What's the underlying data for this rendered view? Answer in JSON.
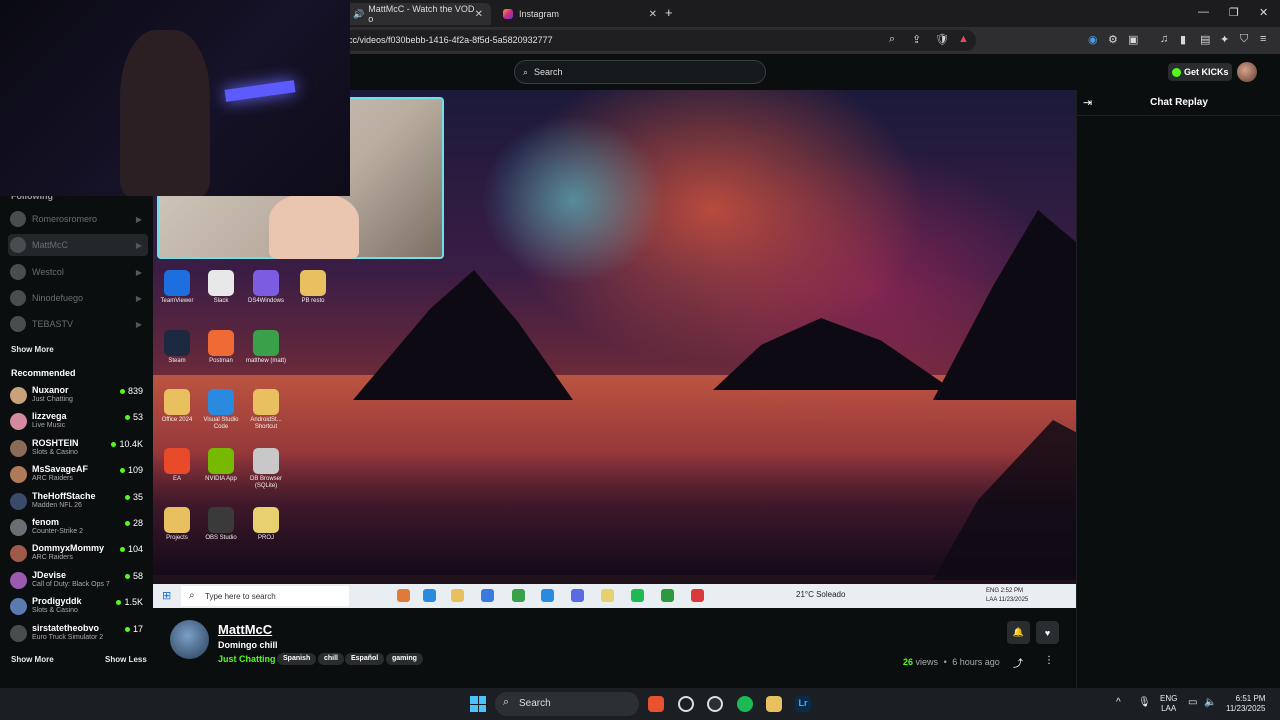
{
  "browser": {
    "tabs": [
      {
        "title": "MattMcC - Watch the VOD o",
        "active": true
      },
      {
        "title": "Instagram",
        "active": false
      }
    ],
    "new_tab": "+",
    "url": "cc/videos/f030bebb-1416-4f2a-8f5d-5a5820932777",
    "window_controls": [
      "—",
      "❐",
      "✕"
    ]
  },
  "header": {
    "search_placeholder": "Search",
    "get_kicks_label": "Get KICKs"
  },
  "sidebar": {
    "following_title": "Following",
    "following": [
      {
        "name": "Romerosromero",
        "selected": false
      },
      {
        "name": "MattMcC",
        "selected": true
      },
      {
        "name": "Westcol",
        "selected": false
      },
      {
        "name": "Ninodefuego",
        "selected": false
      },
      {
        "name": "TEBASTV",
        "selected": false
      }
    ],
    "show_more_following": "Show More",
    "recommended_title": "Recommended",
    "recommended": [
      {
        "name": "Nuxanor",
        "category": "Just Chatting",
        "viewers": "839",
        "color": "#c9a27a"
      },
      {
        "name": "lizzvega",
        "category": "Live Music",
        "viewers": "53",
        "color": "#d38aa0"
      },
      {
        "name": "ROSHTEIN",
        "category": "Slots & Casino",
        "viewers": "10.4K",
        "color": "#8a6b5a"
      },
      {
        "name": "MsSavageAF",
        "category": "ARC Raiders",
        "viewers": "109",
        "color": "#b07a5a"
      },
      {
        "name": "TheHoffStache",
        "category": "Madden NFL 26",
        "viewers": "35",
        "color": "#3a4a6a"
      },
      {
        "name": "fenom",
        "category": "Counter-Strike 2",
        "viewers": "28",
        "color": "#6a6f74"
      },
      {
        "name": "DommyxMommy",
        "category": "ARC Raiders",
        "viewers": "104",
        "color": "#a05a4a"
      },
      {
        "name": "JDevise",
        "category": "Call of Duty: Black Ops 7",
        "viewers": "58",
        "color": "#9a5ab0"
      },
      {
        "name": "Prodigyddk",
        "category": "Slots & Casino",
        "viewers": "1.5K",
        "color": "#5a7ab0"
      },
      {
        "name": "sirstatetheobvo",
        "category": "Euro Truck Simulator 2",
        "viewers": "17",
        "color": "#4a4d50"
      }
    ],
    "show_more": "Show More",
    "show_less": "Show Less"
  },
  "video": {
    "desktop_icons": [
      {
        "label": "TeamViewer",
        "color": "#1d6fe0"
      },
      {
        "label": "Slack",
        "color": "#e8e8e8"
      },
      {
        "label": "DS4Windows",
        "color": "#7c5ce0"
      },
      {
        "label": "PB resto",
        "color": "#e8c060"
      },
      {
        "label": "Steam",
        "color": "#1b2a40"
      },
      {
        "label": "Postman",
        "color": "#f06a35"
      },
      {
        "label": "matthew (matt)",
        "color": "#3aa04a"
      },
      {
        "label": "Office 2024",
        "color": "#e8c060"
      },
      {
        "label": "Visual Studio Code",
        "color": "#2a8ae0"
      },
      {
        "label": "AndroidSt... Shortcut",
        "color": "#e8c060"
      },
      {
        "label": "EA",
        "color": "#e84a2a"
      },
      {
        "label": "NVIDIA App",
        "color": "#76b900"
      },
      {
        "label": "DB Browser (SQLite)",
        "color": "#c8c8c8"
      },
      {
        "label": "Projects",
        "color": "#e8c060"
      },
      {
        "label": "OBS Studio",
        "color": "#3a3a3a"
      },
      {
        "label": "PROJ",
        "color": "#e8d070"
      }
    ],
    "taskbar_search": "Type here to search",
    "weather": "21°C  Soleado",
    "clock_line1": "ENG   2:52 PM",
    "clock_line2": "LAA   11/23/2025"
  },
  "stream": {
    "streamer": "MattMcC",
    "title": "Domingo chill",
    "category": "Just Chatting",
    "tags": [
      "Spanish",
      "chill",
      "Español",
      "gaming"
    ],
    "view_count": "26",
    "views_label": "views",
    "separator": "•",
    "time_ago": "6 hours ago"
  },
  "chat": {
    "title": "Chat Replay"
  },
  "taskbar": {
    "search_label": "Search",
    "lang_line1": "ENG",
    "lang_line2": "LAA",
    "time": "6:51 PM",
    "date": "11/23/2025"
  }
}
